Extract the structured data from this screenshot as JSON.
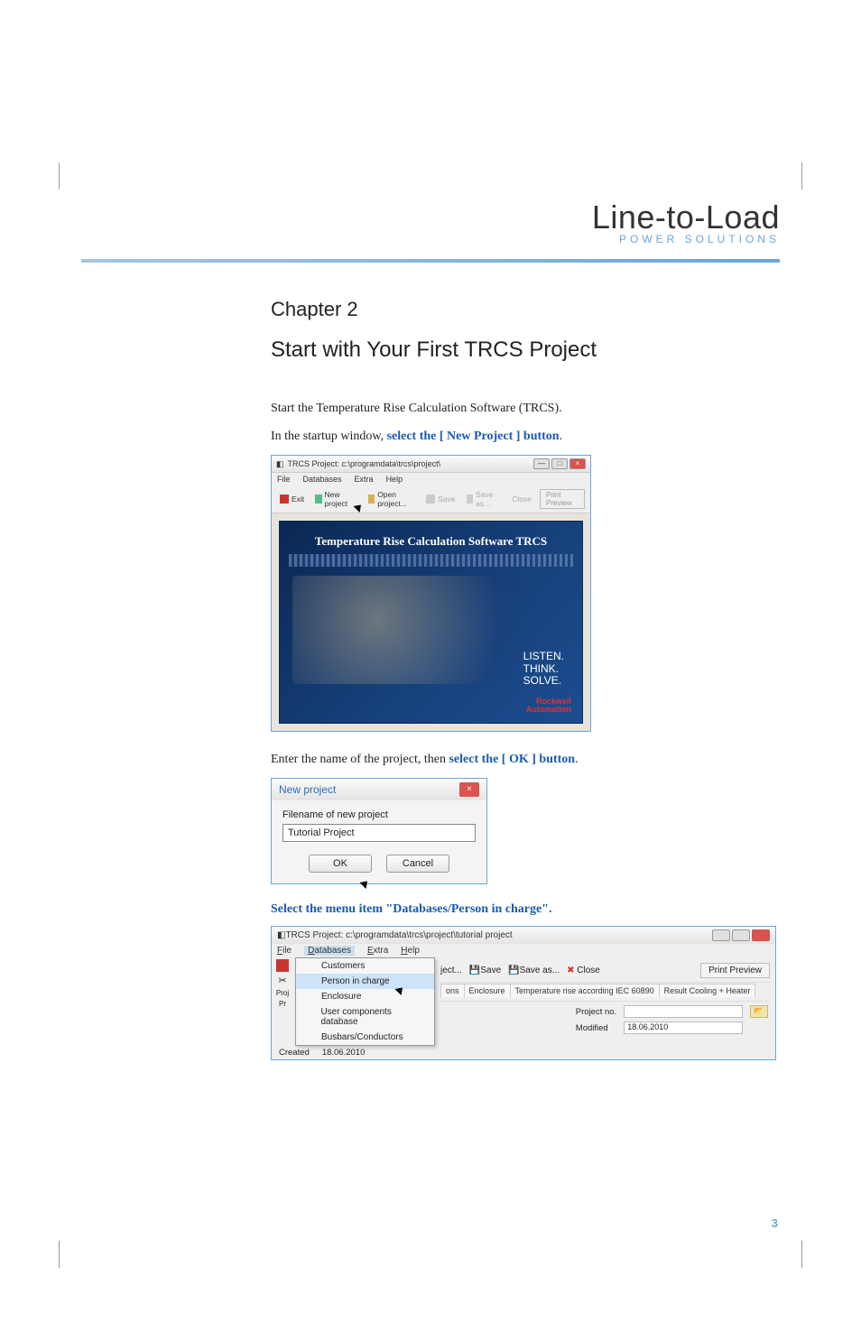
{
  "header": {
    "logo_line1": "Line-to-Load",
    "logo_line2": "POWER SOLUTIONS"
  },
  "chapter": "Chapter 2",
  "title": "Start with Your First TRCS Project",
  "para1": "Start the Temperature Rise Calculation Software (TRCS).",
  "para2_a": "In the startup window, ",
  "para2_b": "select the [ New Project ] button",
  "para2_c": ".",
  "shot1": {
    "title": "TRCS Project: c:\\programdata\\trcs\\project\\",
    "menus": [
      "File",
      "Databases",
      "Extra",
      "Help"
    ],
    "tb_exit": "Exit",
    "tb_new": "New project",
    "tb_open": "Open project...",
    "tb_save": "Save",
    "tb_saveas": "Save as...",
    "tb_close": "Close",
    "tb_print": "Print Preview",
    "splash_title": "Temperature Rise Calculation Software TRCS",
    "tag1": "LISTEN.",
    "tag2": "THINK.",
    "tag3": "SOLVE.",
    "brand1": "Rockwell",
    "brand2": "Automation"
  },
  "para3_a": "Enter the name of the project, then ",
  "para3_b": "select the [ OK ] button",
  "para3_c": ".",
  "shot2": {
    "title": "New project",
    "label": "Filename of new project",
    "value": "Tutorial Project",
    "ok": "OK",
    "cancel": "Cancel"
  },
  "menu_select": "Select the menu item \"Databases/Person in charge\".",
  "shot3": {
    "title": "TRCS Project: c:\\programdata\\trcs\\project\\tutorial project",
    "menus": {
      "file": "File",
      "databases": "Databases",
      "extra": "Extra",
      "help": "Help"
    },
    "dd": {
      "customers": "Customers",
      "person": "Person in charge",
      "enclosure": "Enclosure",
      "user_comp": "User components database",
      "busbars": "Busbars/Conductors"
    },
    "tb": {
      "ject": "ject...",
      "save": "Save",
      "saveas": "Save as...",
      "close": "Close",
      "print": "Print Preview"
    },
    "tabs": {
      "ons": "ons",
      "enclosure": "Enclosure",
      "temp": "Temperature rise according IEC 60890",
      "result": "Result Cooling + Heater"
    },
    "form": {
      "projectno_label": "Project no.",
      "projectno_value": "",
      "created_label": "Created",
      "created_value": "18.06.2010",
      "modified_label": "Modified",
      "modified_value": "18.06.2010"
    },
    "sidebar_proj_label": "Proj",
    "sidebar_pr_label": "Pr",
    "folder_icon": "📂"
  },
  "page_no": "3"
}
